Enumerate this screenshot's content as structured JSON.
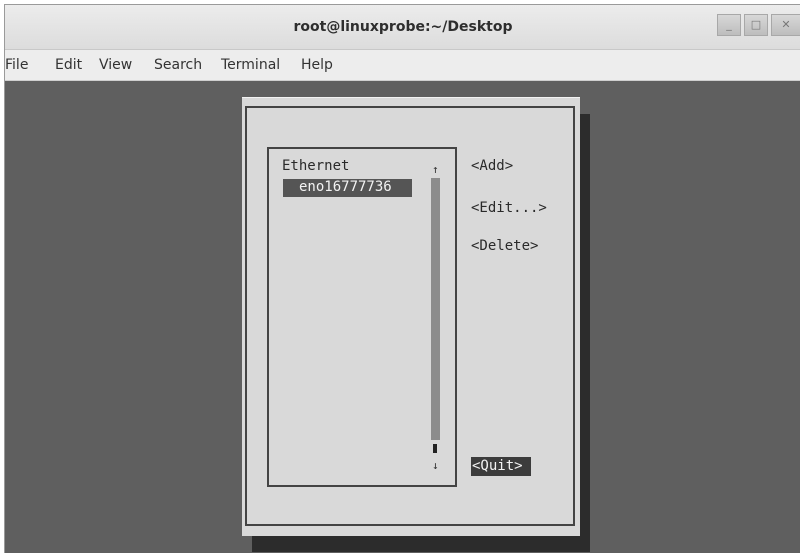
{
  "window": {
    "title": "root@linuxprobe:~/Desktop"
  },
  "menu": [
    "File",
    "Edit",
    "View",
    "Search",
    "Terminal",
    "Help"
  ],
  "nmtui": {
    "list_header": "Ethernet",
    "connections": [
      "eno16777736"
    ],
    "buttons": {
      "add": "<Add>",
      "edit": "<Edit...>",
      "delete": "<Delete>",
      "quit": "<Quit>"
    },
    "scroll_up": "↑",
    "scroll_down": "↓"
  }
}
